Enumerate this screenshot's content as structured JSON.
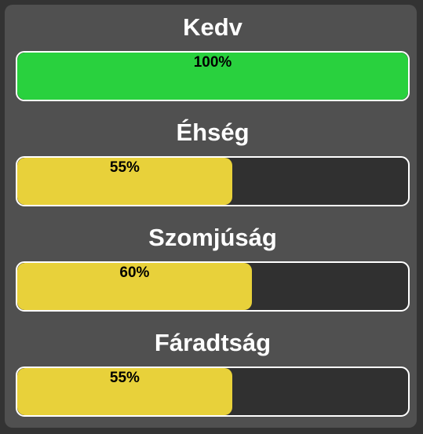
{
  "colors": {
    "full": "#29d13e",
    "partial": "#e8d13a",
    "track": "#303030"
  },
  "stats": [
    {
      "label": "Kedv",
      "value": 100,
      "display": "100%",
      "color": "#29d13e"
    },
    {
      "label": "Éhség",
      "value": 55,
      "display": "55%",
      "color": "#e8d13a"
    },
    {
      "label": "Szomjúság",
      "value": 60,
      "display": "60%",
      "color": "#e8d13a"
    },
    {
      "label": "Fáradtság",
      "value": 55,
      "display": "55%",
      "color": "#e8d13a"
    }
  ]
}
